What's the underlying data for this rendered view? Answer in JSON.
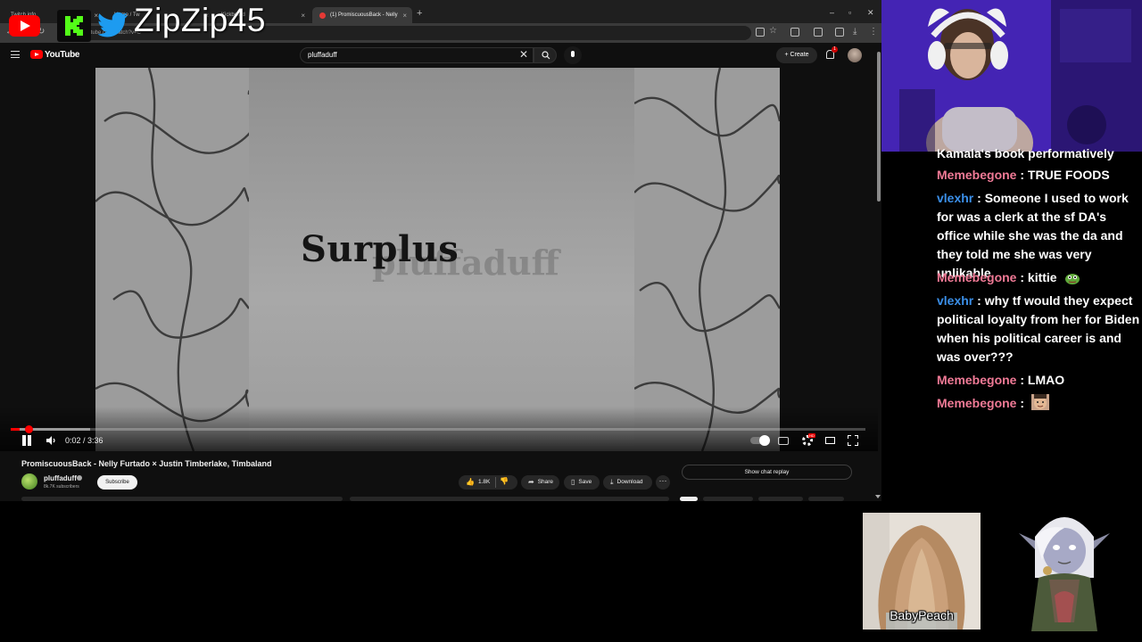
{
  "browser": {
    "tabs": [
      {
        "label": "Twitch info"
      },
      {
        "label": "Mi"
      },
      {
        "label": "Home / Tw"
      },
      {
        "label": "Kickboard"
      },
      {
        "label": "(1) PromiscuousBack - Nelly",
        "active": true
      }
    ],
    "new_tab": "+",
    "url": "youtube.com/watch?v=C"
  },
  "youtube": {
    "logo_text": "YouTube",
    "search_value": "pluffaduff",
    "create_label": "Create",
    "notification_count": "1"
  },
  "video": {
    "overlay_title": "Surplus",
    "overlay_channel": "pluffaduff",
    "time": "0:02 / 3:36",
    "progress_fraction": 0.01,
    "buffer_fraction": 0.093,
    "title": "PromiscuousBack - Nelly Furtado × Justin Timberlake, Timbaland",
    "channel": "pluffaduff",
    "subscribers": "8k.7K subscribers",
    "subscribe_label": "Subscribe",
    "likes": "1.8K",
    "share_label": "Share",
    "save_label": "Save",
    "download_label": "Download",
    "more_label": "···",
    "chat_replay_label": "Show chat replay"
  },
  "overlay": {
    "streamer_handle": "ZipZip45",
    "social_icons": [
      "youtube-icon",
      "kick-icon",
      "twitter-icon"
    ]
  },
  "chat": {
    "messages": [
      {
        "user": "",
        "text": "Kamala's book performatively"
      },
      {
        "user": "Memebegone",
        "text": "TRUE FOODS",
        "color": "#f07a96"
      },
      {
        "user": "vlexhr",
        "text": "Someone I used to work for was a clerk at the sf DA's office while she was the da and they told me she was very unlikable",
        "color": "#3b8fe8"
      },
      {
        "user": "Memebegone",
        "text": "kittie",
        "emote": "pepe-emote",
        "color": "#f07a96"
      },
      {
        "user": "vlexhr",
        "text": "why tf would they expect political loyalty from her for Biden when his political career is and was over???",
        "color": "#3b8fe8"
      },
      {
        "user": "Memebegone",
        "text": "LMAO",
        "color": "#f07a96"
      },
      {
        "user": "Memebegone",
        "text": "",
        "emote": "face-emote",
        "color": "#f07a96"
      }
    ]
  },
  "cam_card": {
    "label": "BabyPeach"
  },
  "colors": {
    "youtube_red": "#ff0000",
    "pink_user": "#f07a96",
    "blue_user": "#3b8fe8"
  }
}
